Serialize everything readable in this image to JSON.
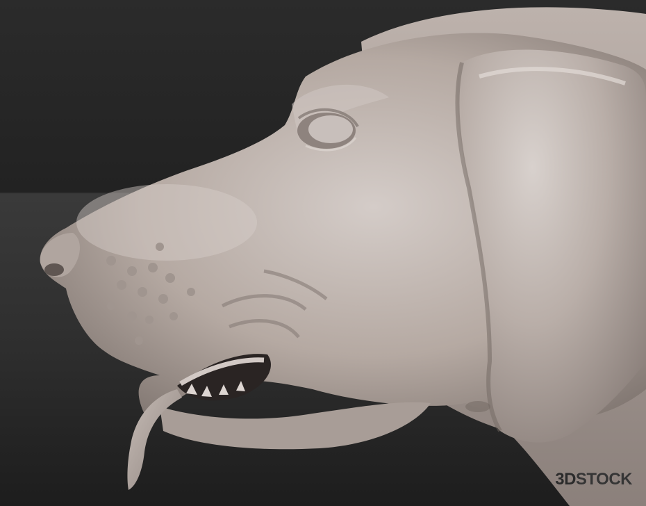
{
  "scene": {
    "subject": "dog-head-sculpt",
    "colors": {
      "background_top": "#2b2b2b",
      "background_floor": "#3a3a3a",
      "clay_base": "#b8aca5",
      "clay_shadow": "#7f746f",
      "clay_highlight": "#d8d0cc",
      "mouth_dark": "#2a2423"
    }
  },
  "watermark": {
    "prefix": "3D",
    "suffix": "STOCK"
  }
}
